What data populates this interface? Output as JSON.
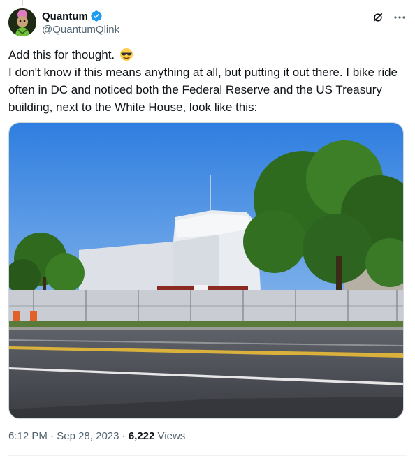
{
  "author": {
    "display_name": "Quantum",
    "handle": "@QuantumQlink",
    "verified": true
  },
  "tweet": {
    "line1": "Add this for thought.",
    "line1_emoji": "smiling-face-with-sunglasses",
    "line2": "I don't know if this means anything at all, but putting it out there. I bike ride often in DC and noticed both the Federal Reserve and the US Treasury building, next to the White House, look like this:"
  },
  "meta": {
    "time": "6:12 PM",
    "separator": "·",
    "date": "Sep 28, 2023",
    "views_count": "6,222",
    "views_label": "Views"
  },
  "icons": {
    "verified": "verified-badge-icon",
    "grok": "grok-icon",
    "more": "more-options-icon"
  },
  "colors": {
    "verified_blue": "#1d9bf0",
    "secondary_text": "#536471",
    "primary_text": "#0f1419",
    "border": "#cfd9de"
  }
}
